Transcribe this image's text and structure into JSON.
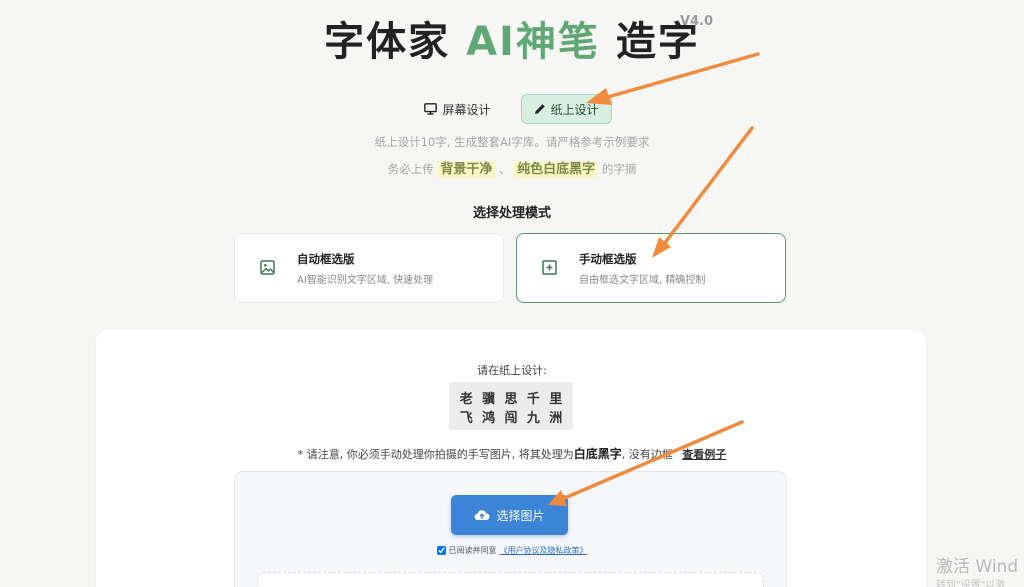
{
  "header": {
    "title_part1": "字体家 ",
    "title_ai": "AI神笔",
    "title_part2": " 造字",
    "version": "V4.0",
    "accent_color": "#5fa875"
  },
  "mode_tabs": [
    {
      "label": "屏幕设计",
      "icon": "monitor-icon",
      "active": false
    },
    {
      "label": "纸上设计",
      "icon": "pencil-icon",
      "active": true
    }
  ],
  "hints": {
    "line1": "纸上设计10字, 生成整套AI字库。请严格参考示例要求",
    "line2_prefix": "务必上传",
    "highlight1": "背景干净",
    "separator": "、",
    "highlight2": "纯色白底黑字",
    "line2_suffix": "的字摘"
  },
  "processing": {
    "title": "选择处理模式",
    "options": [
      {
        "title": "自动框选版",
        "desc": "AI智能识别文字区域, 快速处理",
        "icon": "image-icon",
        "selected": false
      },
      {
        "title": "手动框选版",
        "desc": "自由框选文字区域, 精确控制",
        "icon": "plus-square-icon",
        "selected": true
      }
    ]
  },
  "upload": {
    "please_label": "请在纸上设计:",
    "sample_chars": [
      "老",
      "骥",
      "思",
      "千",
      "里",
      "飞",
      "鸿",
      "闯",
      "九",
      "洲"
    ],
    "notice_text": "* 请注意, 你必须手动处理你拍摄的手写图片, 将其处理为",
    "notice_bold": "白底黑字",
    "notice_tail": ", 没有边框",
    "example_link": "查看例子",
    "button_label": "选择图片",
    "agree_text": "已阅读并同意",
    "agree_link": "《用户协议及隐私政策》",
    "agree_checked": true,
    "button_color": "#3c84d6"
  },
  "watermark": {
    "line1": "激活 Wind",
    "line2": "转到\"设置\"以激"
  },
  "annotation_color": "#f08a3c"
}
